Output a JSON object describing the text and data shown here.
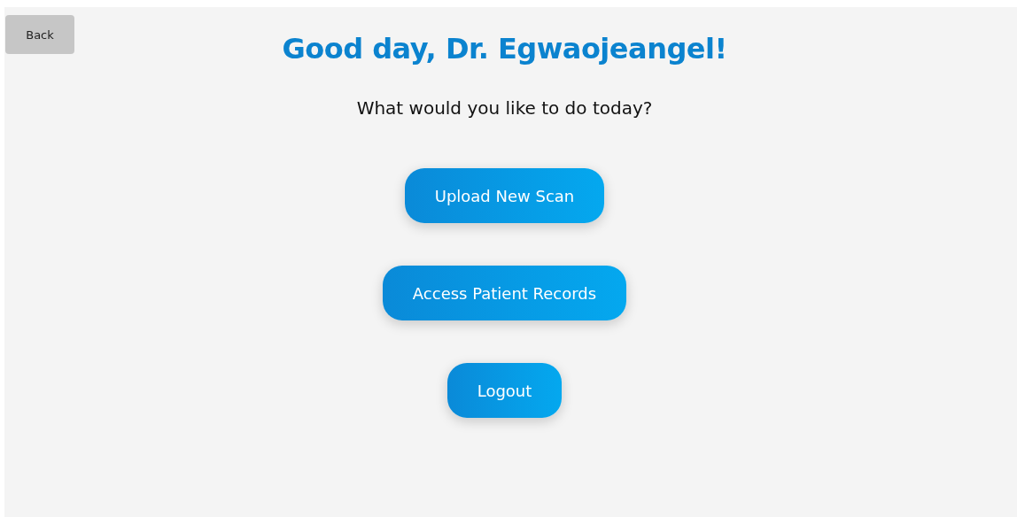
{
  "back_button": {
    "label": "Back"
  },
  "greeting": "Good day, Dr. Egwaojeangel!",
  "prompt": "What would you like to do today?",
  "actions": [
    {
      "label": "Upload New Scan"
    },
    {
      "label": "Access Patient Records"
    },
    {
      "label": "Logout"
    }
  ]
}
